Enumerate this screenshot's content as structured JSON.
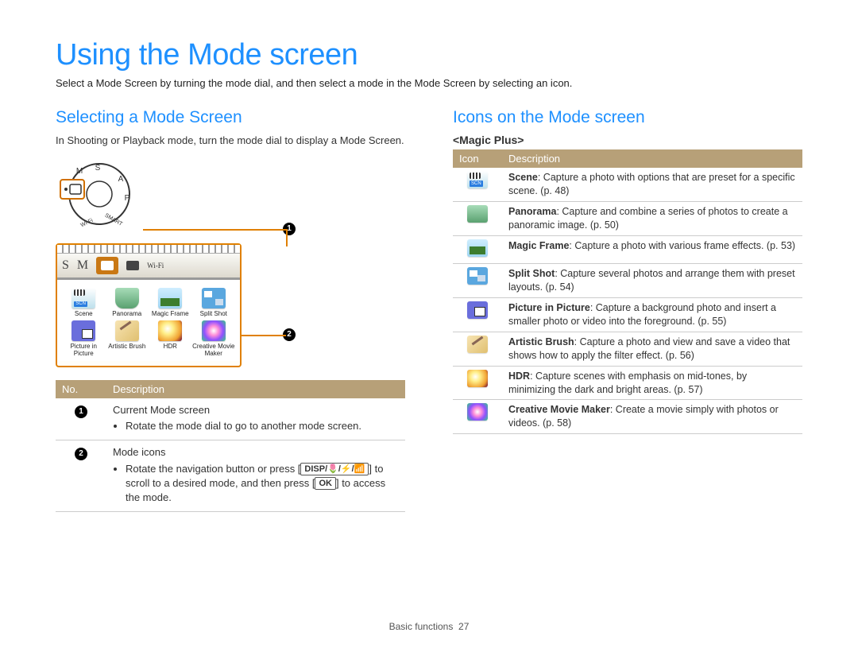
{
  "page": {
    "title": "Using the Mode screen",
    "intro": "Select a Mode Screen by turning the mode dial, and then select a mode in the Mode Screen by selecting an icon.",
    "footer_section": "Basic functions",
    "footer_page": "27"
  },
  "left": {
    "heading": "Selecting a Mode Screen",
    "body": "In Shooting or Playback mode, turn the mode dial to display a Mode Screen.",
    "dial_labels": {
      "top": "S",
      "right": "A",
      "bottomRight": "P",
      "bottom": "SMART",
      "bottomLeft": "Wi-Fi",
      "left": "M"
    },
    "tabs": {
      "s": "S",
      "m": "M",
      "wifi": "Wi-Fi"
    },
    "grid": [
      {
        "label": "Scene",
        "icon": "scene"
      },
      {
        "label": "Panorama",
        "icon": "pano"
      },
      {
        "label": "Magic Frame",
        "icon": "frame"
      },
      {
        "label": "Split Shot",
        "icon": "split"
      },
      {
        "label": "Picture in Picture",
        "icon": "pip"
      },
      {
        "label": "Artistic Brush",
        "icon": "brush"
      },
      {
        "label": "HDR",
        "icon": "hdr"
      },
      {
        "label": "Creative Movie Maker",
        "icon": "movie"
      }
    ],
    "table": {
      "headers": {
        "no": "No.",
        "desc": "Description"
      },
      "row1": {
        "title": "Current Mode screen",
        "bullet": "Rotate the mode dial to go to another mode screen."
      },
      "row2": {
        "title": "Mode icons",
        "bullet_part1": "Rotate the navigation button or press [",
        "disp": "DISP",
        "bullet_part2": "] to scroll to a desired mode, and then press [",
        "ok": "OK",
        "bullet_part3": "] to access the mode."
      }
    }
  },
  "right": {
    "heading": "Icons on the Mode screen",
    "subhead": "<Magic Plus>",
    "headers": {
      "icon": "Icon",
      "desc": "Description"
    },
    "rows": [
      {
        "icon": "scene",
        "bold": "Scene",
        "text": ": Capture a photo with options that are preset for a specific scene. (p. 48)"
      },
      {
        "icon": "pano",
        "bold": "Panorama",
        "text": ": Capture and combine a series of photos to create a panoramic image. (p. 50)"
      },
      {
        "icon": "frame",
        "bold": "Magic Frame",
        "text": ": Capture a photo with various frame effects. (p. 53)"
      },
      {
        "icon": "split",
        "bold": "Split Shot",
        "text": ": Capture several photos and arrange them with preset layouts. (p. 54)"
      },
      {
        "icon": "pip",
        "bold": "Picture in Picture",
        "text": ": Capture a background photo and insert a smaller photo or video into the foreground. (p. 55)"
      },
      {
        "icon": "brush",
        "bold": "Artistic Brush",
        "text": ": Capture a photo and view and save a video that shows how to apply the filter effect. (p. 56)"
      },
      {
        "icon": "hdr",
        "bold": "HDR",
        "text": ": Capture scenes with emphasis on mid-tones, by minimizing the dark and bright areas. (p. 57)"
      },
      {
        "icon": "movie",
        "bold": "Creative Movie Maker",
        "text": ": Create a movie simply with photos or videos. (p. 58)"
      }
    ]
  }
}
